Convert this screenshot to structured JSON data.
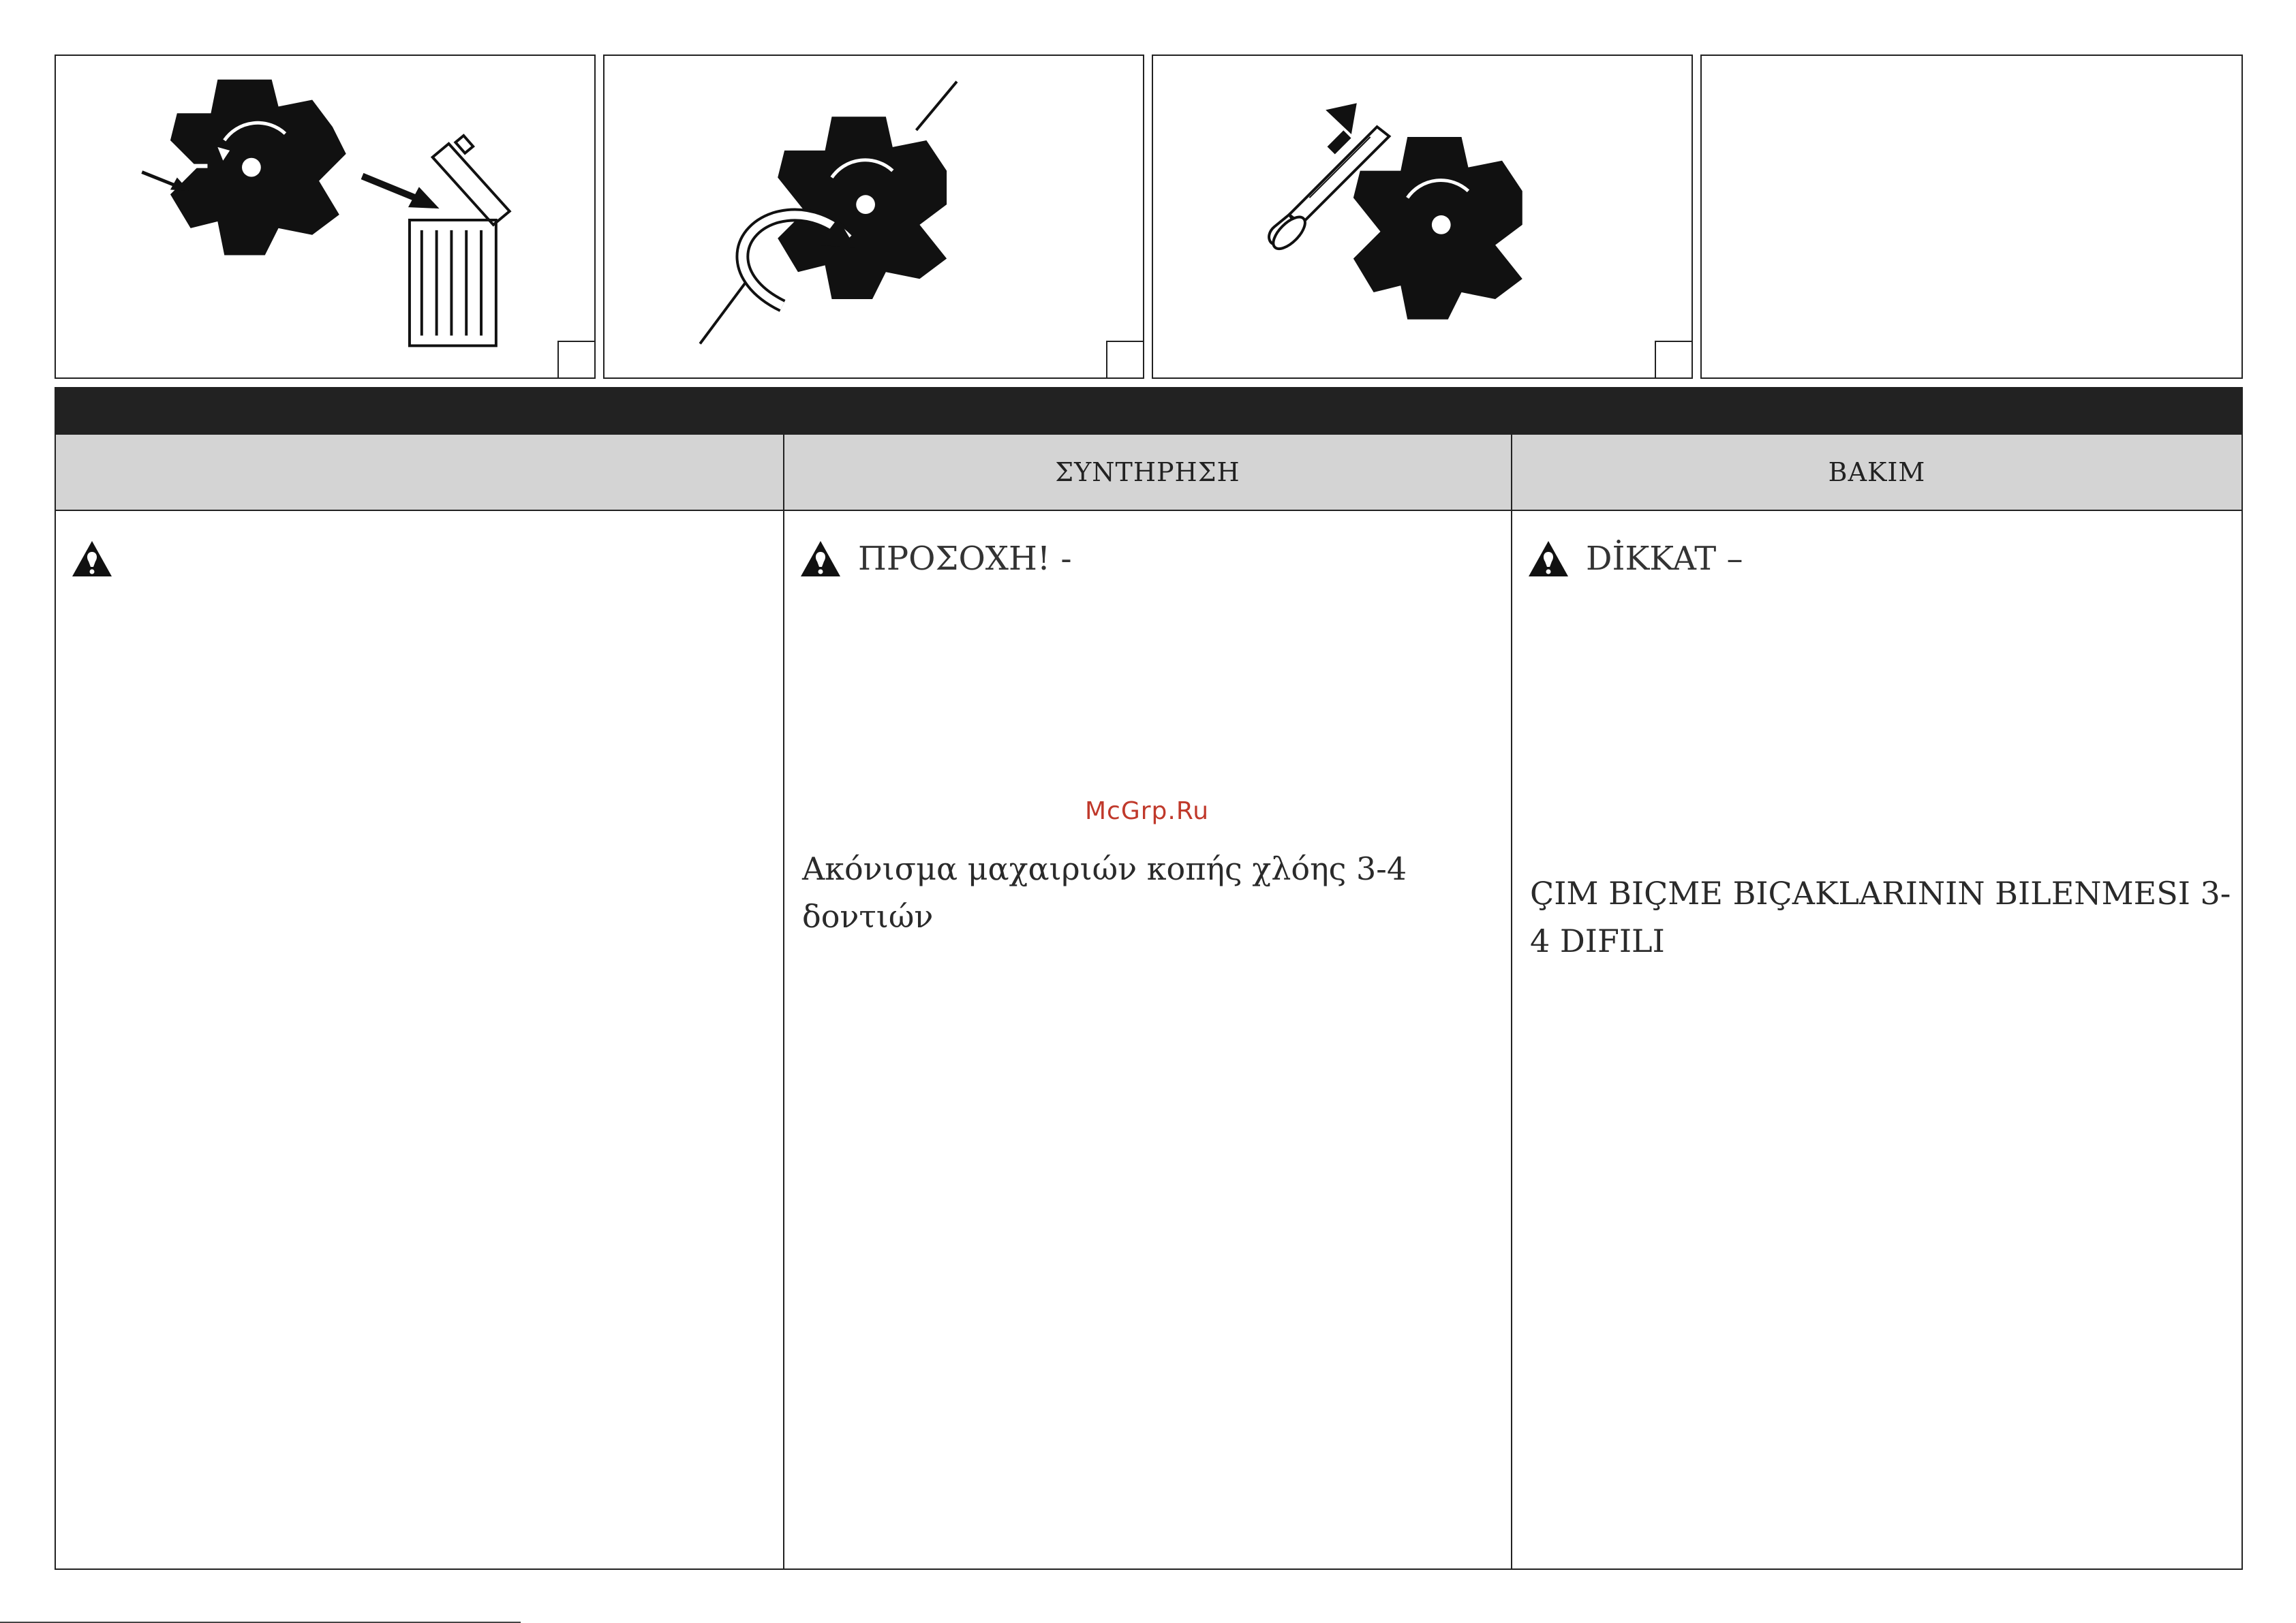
{
  "columns": [
    {
      "section_title": "",
      "warning": {
        "label": ""
      },
      "heading": ""
    },
    {
      "section_title": "ΣΥΝΤΗΡΗΣΗ",
      "warning": {
        "label": "ΠΡΟΣΟΧΗ!  -"
      },
      "heading": "Ακόνισμα μαχαιριών κοπής χλόης 3-4 δοντιών"
    },
    {
      "section_title": "BAKIM",
      "warning": {
        "label": "DİKKAT  –"
      },
      "heading": "ÇIM BIÇME BIÇAKLARININ BILENMESI 3-4 DIFILI"
    }
  ],
  "watermark": "McGrp.Ru",
  "icons": {
    "panel1": [
      "blade-icon",
      "arrow-icon",
      "trash-bin-icon"
    ],
    "panel2": [
      "blade-icon",
      "rotation-arrow-icon"
    ],
    "panel3": [
      "blade-icon",
      "file-tool-icon",
      "arrow-icon"
    ],
    "warning": "warning-triangle-icon"
  }
}
